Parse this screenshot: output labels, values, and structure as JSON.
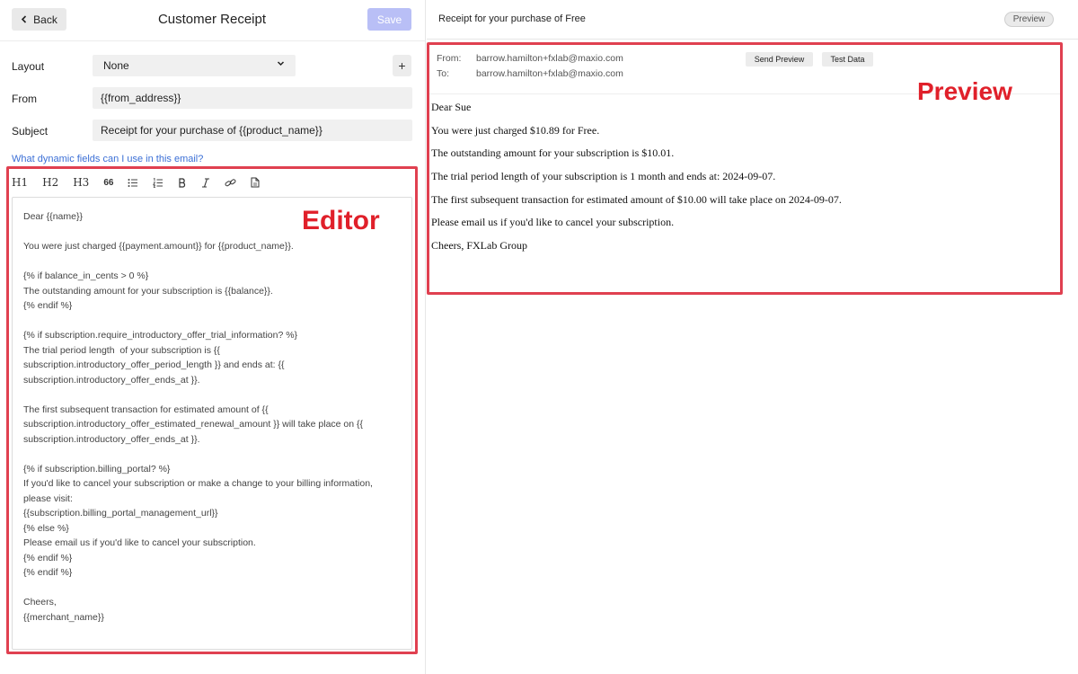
{
  "header": {
    "back_label": "Back",
    "title": "Customer Receipt",
    "save_label": "Save"
  },
  "form": {
    "layout_label": "Layout",
    "layout_value": "None",
    "add_label": "+",
    "from_label": "From",
    "from_value": "{{from_address}}",
    "subject_label": "Subject",
    "subject_value": "Receipt for your purchase of {{product_name}}",
    "help_link": "What dynamic fields can I use in this email?"
  },
  "toolbar": {
    "h1": "H1",
    "h2": "H2",
    "h3": "H3",
    "quote": "66"
  },
  "editor": {
    "content": "Dear {{name}}\n\nYou were just charged {{payment.amount}} for {{product_name}}.\n\n{% if balance_in_cents > 0 %}\nThe outstanding amount for your subscription is {{balance}}.\n{% endif %}\n\n{% if subscription.require_introductory_offer_trial_information? %}\nThe trial period length  of your subscription is {{\nsubscription.introductory_offer_period_length }} and ends at: {{\nsubscription.introductory_offer_ends_at }}.\n\nThe first subsequent transaction for estimated amount of {{\nsubscription.introductory_offer_estimated_renewal_amount }} will take place on {{\nsubscription.introductory_offer_ends_at }}.\n\n{% if subscription.billing_portal? %}\nIf you'd like to cancel your subscription or make a change to your billing information,\nplease visit:\n{{subscription.billing_portal_management_url}}\n{% else %}\nPlease email us if you'd like to cancel your subscription.\n{% endif %}\n{% endif %}\n\nCheers,\n{{merchant_name}}"
  },
  "annotations": {
    "editor_label": "Editor",
    "preview_label": "Preview"
  },
  "preview": {
    "title": "Receipt for your purchase of Free",
    "pill": "Preview",
    "from_key": "From:",
    "from_value": "barrow.hamilton+fxlab@maxio.com",
    "to_key": "To:",
    "to_value": "barrow.hamilton+fxlab@maxio.com",
    "send_preview": "Send Preview",
    "test_data": "Test Data",
    "body": [
      "Dear Sue",
      "You were just charged $10.89 for Free.",
      "The outstanding amount for your subscription is $10.01.",
      "The trial period length of your subscription is 1 month and ends at: 2024-09-07.",
      "The first subsequent transaction for estimated amount of $10.00 will take place on 2024-09-07.",
      "Please email us if you'd like to cancel your subscription.",
      "Cheers, FXLab Group"
    ]
  },
  "colors": {
    "accent_save": "#b9bff6",
    "annotation_red": "#e0202a",
    "link_blue": "#3b6fd6"
  }
}
